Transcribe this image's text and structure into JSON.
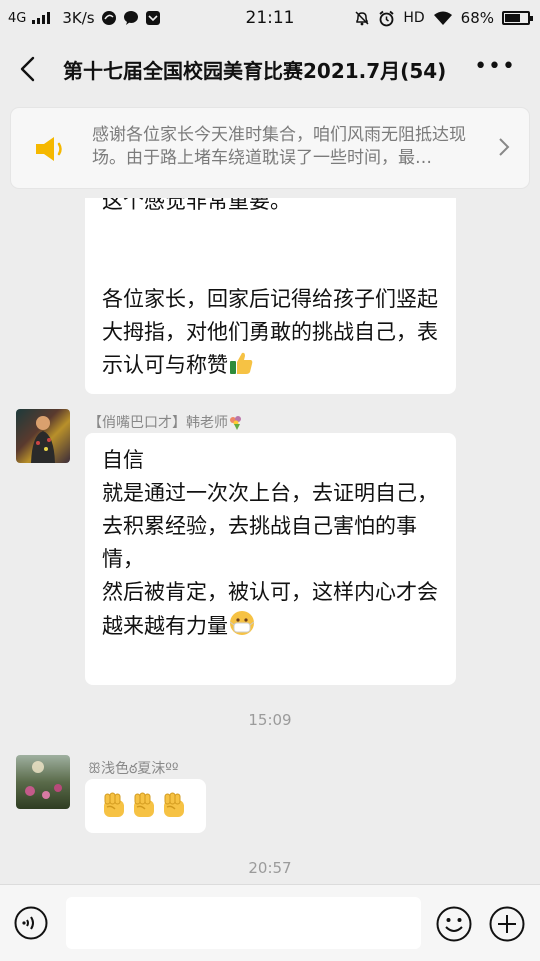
{
  "status_bar": {
    "network": "4G",
    "speed": "3K/s",
    "time": "21:11",
    "hd": "HD",
    "battery": "68%",
    "battery_level": 0.68
  },
  "header": {
    "title": "第十七届全国校园美育比赛2021.7月(54)",
    "more": "•••"
  },
  "notice": {
    "text": "感谢各位家长今天准时集合，咱们风雨无阻抵达现场。由于路上堵车绕道耽误了一些时间，最…"
  },
  "messages": {
    "m1": {
      "top_line": "这个感觉非常重要。",
      "body": "各位家长，回家后记得给孩子们竖起大拇指，对他们勇敢的挑战自己，表示认可与称赞"
    },
    "m2": {
      "sender": "【俏嘴巴口才】韩老师",
      "lines": [
        "自信",
        "就是通过一次次上台，去证明自己，",
        "去积累经验，去挑战自己害怕的事情，",
        "然后被肯定，被认可，这样内心才会越来越有力量"
      ]
    },
    "time1": "15:09",
    "m3": {
      "sender": "ꕥ浅色ఠ夏沫ºº"
    },
    "time2": "20:57"
  },
  "input": {
    "value": ""
  },
  "icons": {
    "voice": "voice-icon",
    "emoji": "emoji-icon",
    "plus": "plus-icon",
    "speaker": "speaker-icon"
  }
}
